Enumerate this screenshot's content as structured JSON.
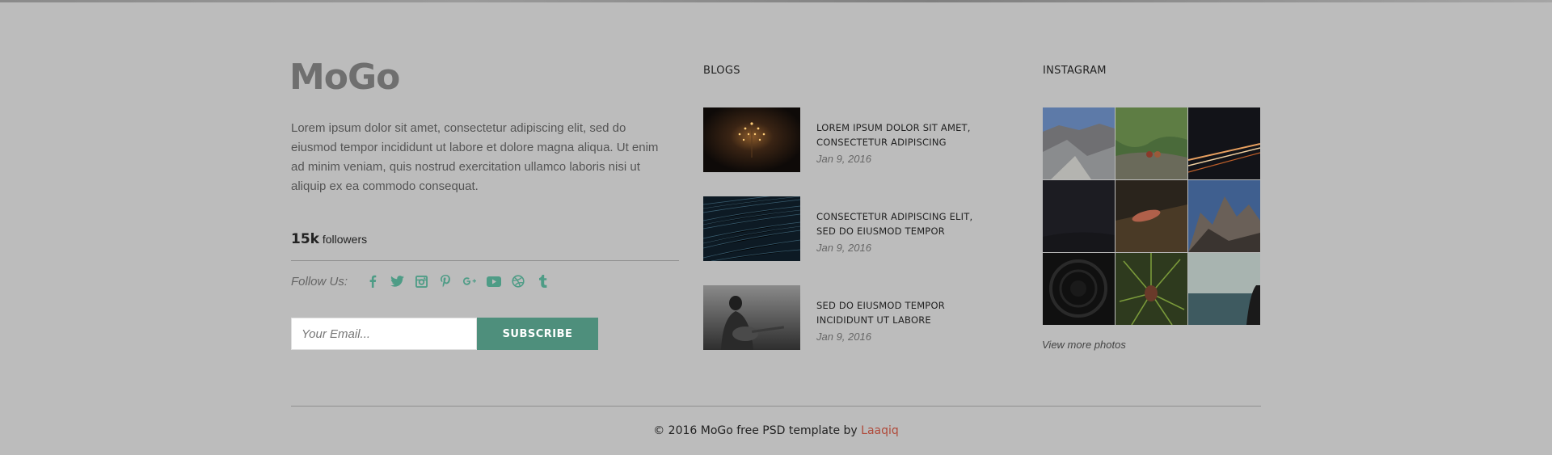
{
  "brand": {
    "logo": "MoGo"
  },
  "about": {
    "text": "Lorem ipsum dolor sit amet, consectetur adipiscing elit, sed do eiusmod tempor incididunt ut labore et dolore magna aliqua. Ut enim ad minim veniam, quis nostrud exercitation ullamco laboris nisi ut aliquip ex ea commodo consequat.",
    "followers_count": "15k",
    "followers_label": "followers",
    "follow_us": "Follow Us:"
  },
  "social_icons": [
    "facebook-icon",
    "twitter-icon",
    "instagram-icon",
    "pinterest-icon",
    "google-plus-icon",
    "youtube-icon",
    "dribbble-icon",
    "tumblr-icon"
  ],
  "subscribe": {
    "placeholder": "Your Email...",
    "button": "SUBSCRIBE"
  },
  "blogs": {
    "title": "BLOGS",
    "items": [
      {
        "title": "LOREM IPSUM DOLOR SIT AMET, CONSECTETUR ADIPISCING",
        "date": "Jan 9, 2016"
      },
      {
        "title": "CONSECTETUR ADIPISCING ELIT, SED DO EIUSMOD TEMPOR",
        "date": "Jan 9, 2016"
      },
      {
        "title": "SED DO EIUSMOD TEMPOR INCIDIDUNT UT LABORE",
        "date": "Jan 9, 2016"
      }
    ]
  },
  "instagram": {
    "title": "INSTAGRAM",
    "more": "View more photos"
  },
  "footer": {
    "copyright": "© 2016 MoGo free PSD template by",
    "author": "Laaqiq"
  },
  "colors": {
    "accent": "#4e8f7c",
    "icon": "#4e9c86",
    "author_link": "#b04a3a",
    "background": "#bcbcbc"
  }
}
